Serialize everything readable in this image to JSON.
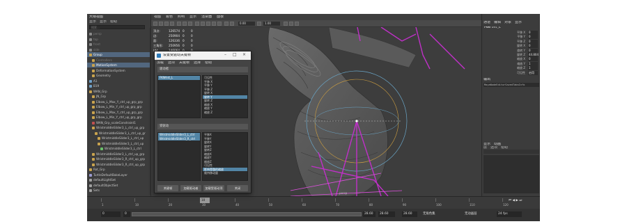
{
  "outliner": {
    "title": "大纲视图",
    "menu": [
      "显示",
      "显示",
      "帮助"
    ],
    "search_placeholder": "搜索...",
    "rows": [
      {
        "label": "persp",
        "indent": 0,
        "dim": true,
        "icon": "camera-icon",
        "sel": false
      },
      {
        "label": "top",
        "indent": 0,
        "dim": true,
        "icon": "camera-icon",
        "sel": false
      },
      {
        "label": "front",
        "indent": 0,
        "dim": true,
        "icon": "camera-icon",
        "sel": false
      },
      {
        "label": "side",
        "indent": 0,
        "dim": true,
        "icon": "camera-icon",
        "sel": false
      },
      {
        "label": "Group",
        "indent": 0,
        "dim": false,
        "icon": "group-icon",
        "sel": true
      },
      {
        "label": "Controllers",
        "indent": 1,
        "dim": true,
        "icon": "group-icon",
        "sel": false
      },
      {
        "label": "MotionSystem",
        "indent": 1,
        "dim": false,
        "icon": "group-icon",
        "sel": true
      },
      {
        "label": "DeformationSystem",
        "indent": 1,
        "dim": false,
        "icon": "group-icon",
        "sel": false
      },
      {
        "label": "Geometry",
        "indent": 1,
        "dim": false,
        "icon": "group-icon",
        "sel": false
      },
      {
        "label": "A1",
        "indent": 0,
        "dim": false,
        "icon": "mesh-icon",
        "sel": false
      },
      {
        "label": "B19",
        "indent": 0,
        "dim": false,
        "icon": "mesh-icon",
        "sel": false
      },
      {
        "label": "WAN_Grp",
        "indent": 0,
        "dim": false,
        "icon": "group-icon",
        "sel": false
      },
      {
        "label": "JN_Grp",
        "indent": 1,
        "dim": false,
        "icon": "group-icon",
        "sel": false
      },
      {
        "label": "Elbow_L_Max_Y_ctrl_up_grp_grp",
        "indent": 1,
        "dim": false,
        "icon": "group-icon",
        "sel": false
      },
      {
        "label": "Elbow_L_Min_Y_ctrl_up_grp_grp",
        "indent": 1,
        "dim": false,
        "icon": "group-icon",
        "sel": false
      },
      {
        "label": "Elbow_L_Max_Y_ctrl_up_grp_grp",
        "indent": 1,
        "dim": false,
        "icon": "group-icon",
        "sel": false
      },
      {
        "label": "Elbow_L_Min_Y_ctrl_up_grp_grp",
        "indent": 1,
        "dim": false,
        "icon": "group-icon",
        "sel": false
      },
      {
        "label": "WAN_Grp_scaleConstraint1",
        "indent": 1,
        "dim": false,
        "icon": "constraint-icon",
        "sel": false
      },
      {
        "label": "WristmiddleSlider3_L_ctrl_up_grp",
        "indent": 1,
        "dim": false,
        "icon": "group-icon",
        "sel": false
      },
      {
        "label": "WristmiddleSlider3_L_ctrl_up_gr",
        "indent": 2,
        "dim": false,
        "icon": "group-icon",
        "sel": false
      },
      {
        "label": "WristmiddleSlider3_L_ctrl_up",
        "indent": 3,
        "dim": false,
        "icon": "group-icon",
        "sel": false
      },
      {
        "label": "WristmiddleSlider3_L_ctrl_up",
        "indent": 3,
        "dim": false,
        "icon": "group-icon",
        "sel": false
      },
      {
        "label": "WristmiddleSlider3_L_ctrl",
        "indent": 4,
        "dim": false,
        "icon": "curve-icon",
        "sel": false
      },
      {
        "label": "WristmiddleSlider3_L_ctrl_up_grp",
        "indent": 1,
        "dim": false,
        "icon": "group-icon",
        "sel": false
      },
      {
        "label": "WristmiddleSlider3_R_ctrl_up_grp",
        "indent": 1,
        "dim": false,
        "icon": "group-icon",
        "sel": false
      },
      {
        "label": "WristmiddleSlider3_R_ctrl_up_grp",
        "indent": 1,
        "dim": false,
        "icon": "group-icon",
        "sel": false
      },
      {
        "label": "Rot_Grp",
        "indent": 0,
        "dim": false,
        "icon": "group-icon",
        "sel": false
      },
      {
        "label": "TurtleDefaultBakeLayer",
        "indent": 0,
        "dim": false,
        "icon": "layer-icon",
        "sel": false
      },
      {
        "label": "defaultLightSet",
        "indent": 0,
        "dim": false,
        "icon": "set-icon",
        "sel": false
      },
      {
        "label": "defaultObjectSet",
        "indent": 0,
        "dim": false,
        "icon": "set-icon",
        "sel": false
      },
      {
        "label": "Sets",
        "indent": 0,
        "dim": false,
        "icon": "set-icon",
        "sel": false
      }
    ]
  },
  "viewport": {
    "menu": [
      "视图",
      "着色",
      "照明",
      "显示",
      "渲染器",
      "面板"
    ],
    "field_a": "0.00",
    "field_b": "1.00",
    "stats": [
      [
        "顶点:",
        "126574",
        "0",
        "0"
      ],
      [
        "边:",
        "250904",
        "0",
        "0"
      ],
      [
        "面:",
        "126336",
        "0",
        "0"
      ],
      [
        "三角形:",
        "250956",
        "0",
        "0"
      ],
      [
        "UV:",
        "146064",
        "0",
        "0"
      ]
    ],
    "camera_label": "persp"
  },
  "attributes": {
    "tabs": [
      "通道",
      "编辑",
      "对象",
      "显示"
    ],
    "object_name": "FKWrist_L",
    "rows": [
      [
        "平移 X",
        "0"
      ],
      [
        "平移 Y",
        "0"
      ],
      [
        "平移 Z",
        "0"
      ],
      [
        "旋转 X",
        "0"
      ],
      [
        "旋转 Y",
        "0"
      ],
      [
        "旋转 Z",
        "44.804"
      ],
      [
        "缩放 X",
        "0"
      ],
      [
        "缩放 Y",
        "1"
      ],
      [
        "缩放 Z",
        "1"
      ],
      [
        "可见性",
        "启用"
      ]
    ],
    "output_title": "输出",
    "output_cmd": "MayaNodeEditorSavedTabsInfo",
    "layer_tabs": [
      "显示",
      "动画"
    ],
    "layer_menu": [
      "层",
      "选项",
      "帮助"
    ]
  },
  "timeline": {
    "ticks": [
      "1",
      "10",
      "20",
      "30",
      "40",
      "50",
      "60",
      "70",
      "80",
      "90",
      "100",
      "110",
      "120"
    ],
    "current_frame": "10",
    "range_start": "0",
    "range_start_inner": "0",
    "range_end_inner": "28.60",
    "range_end": "28.60",
    "range_end_outer": "28.60",
    "char_set": "无角色集",
    "anim_layer": "无动画层",
    "fps": "24 fps"
  },
  "dialog": {
    "title": "设置受驱动关键帧",
    "menu": [
      "加载",
      "选项",
      "关键帧",
      "选择",
      "帮助"
    ],
    "driver_section": "驱动者",
    "driver_objects": [
      "FKWrist_L"
    ],
    "driver_attrs": [
      "可见性",
      "平移 X",
      "平移 Y",
      "平移 Z",
      "旋转 X",
      "旋转 Y",
      "旋转 Z",
      "缩放 X",
      "缩放 Y",
      "缩放 Z"
    ],
    "driver_attr_selected": 5,
    "driven_section": "受驱动",
    "driven_objects": [
      "WristmiddleSlider3_L_ctrl",
      "WristmiddleSlider3_R_ctrl"
    ],
    "driven_attrs": [
      "平移X",
      "平移Y",
      "旋转X",
      "旋转Y",
      "旋转Z",
      "缩放X",
      "缩放Y",
      "缩放Z",
      "可见性",
      "影响骨骼的缩放",
      "维持移动量"
    ],
    "driven_attr_selected": 9,
    "buttons": [
      "关键帧",
      "加载驱动者",
      "加载受驱动项",
      "关闭"
    ]
  }
}
